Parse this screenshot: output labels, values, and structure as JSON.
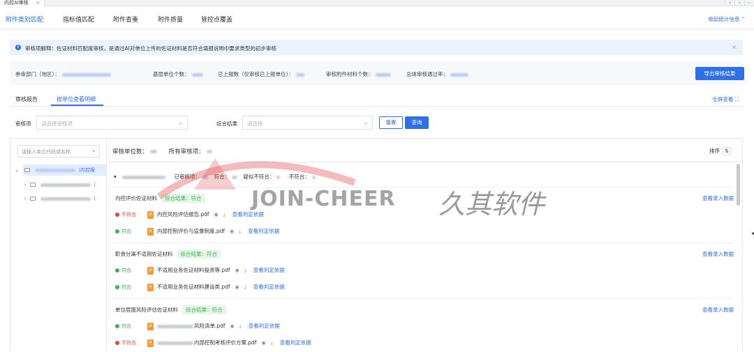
{
  "window": {
    "tab_title": "内控AI审核",
    "tab_close": "×",
    "nav_prev": "‹",
    "nav_next": "›",
    "nav_more": "⋯"
  },
  "main_tabs": [
    {
      "label": "附件类别匹配",
      "active": true
    },
    {
      "label": "指标值匹配"
    },
    {
      "label": "附件查重"
    },
    {
      "label": "附件质量"
    },
    {
      "label": "管控点覆盖"
    }
  ],
  "collapse_label": "收起统计信息 ⌃",
  "alert": {
    "icon": "info-icon",
    "text": "审核项解释：佐证材料匹配度审核，是通过AI对单位上传的佐证材料是否符合填报说明中要求类型的初步审核",
    "close": "×"
  },
  "stats": {
    "dept_label": "参审部门（地区）：",
    "base_units_label": "基层单位个数：",
    "reported_label": "已上报数（仅审核已上报单位）：",
    "attachments_label": "审核附件材料个数：",
    "pass_rate_label": "总体审核通过率："
  },
  "export_label": "导出审核结果",
  "sub_tabs": [
    {
      "label": "审核报告"
    },
    {
      "label": "按单位查看明细",
      "active": true
    }
  ],
  "fullscreen_label": "全屏查看 ⛶",
  "filters": {
    "item_label": "审核项",
    "item_placeholder": "请选择审核项",
    "result_label": "综合结果",
    "result_placeholder": "请选择",
    "reset_label": "重置",
    "query_label": "查询"
  },
  "tree": {
    "search_placeholder": "请输入单位代码或名称",
    "root_suffix": "（内控报",
    "child_suffix_1": "（",
    "child_suffix_2": "（"
  },
  "right": {
    "unit_count_label": "审核单位数：",
    "all_items_label": "所有审核项：",
    "sort_label": "排序",
    "unit_row": {
      "audited": "已审核项：",
      "ok": "符合：",
      "suspect": "疑似不符合：",
      "bad": "不符合："
    }
  },
  "cards": [
    {
      "title": "内控评价佐证材料",
      "result": "综合结果：符合",
      "link": "查看录入数据",
      "files": [
        {
          "status": "不符合",
          "status_type": "bad",
          "name": "内控风险评估报告.pdf",
          "judge": "查看判定依据"
        },
        {
          "status": "符合",
          "status_type": "ok",
          "name": "内部控制评价与监督制度.pdf",
          "judge": "查看判定依据"
        }
      ]
    },
    {
      "title": "职责分离不适用佐证材料",
      "result": "综合结果：符合",
      "link": "查看录入数据",
      "files": [
        {
          "status": "符合",
          "status_type": "ok",
          "name": "不适用业务佐证材料投资等.pdf",
          "judge": "查看判定依据"
        },
        {
          "status": "符合",
          "status_type": "ok",
          "name": "不适用业务佐证材料建设类.pdf",
          "judge": "查看判定依据"
        }
      ]
    },
    {
      "title": "单位层面风险评估佐证材料",
      "result": "综合结果：符合",
      "link": "查看录入数据",
      "files": [
        {
          "status": "符合",
          "status_type": "ok",
          "name": "风险清单.pdf",
          "judge": "查看判定依据"
        },
        {
          "status": "不符合",
          "status_type": "bad",
          "name": "内部控制考核评价方案.pdf",
          "judge": "查看判定依据"
        }
      ]
    }
  ],
  "watermark": {
    "en": "JOIN-CHEER",
    "cn": "久其软件"
  },
  "colors": {
    "accent": "#2f6fe8",
    "ok": "#3bb54a",
    "bad": "#e8463d",
    "alert_bg": "#eaf3fe"
  }
}
